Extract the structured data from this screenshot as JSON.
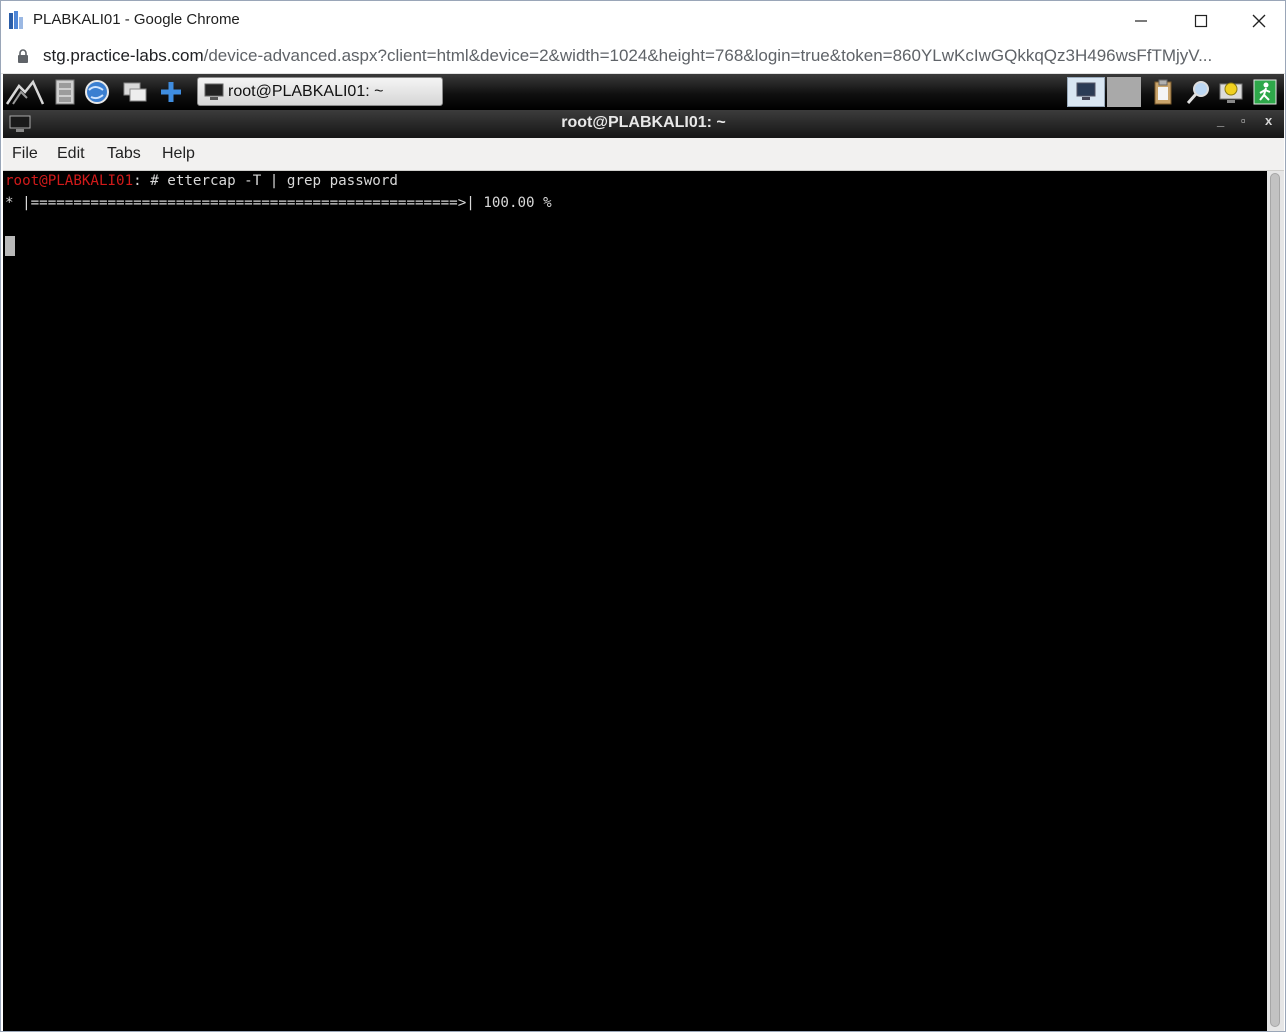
{
  "browser": {
    "window_title": "PLABKALI01 - Google Chrome",
    "url_host": "stg.practice-labs.com",
    "url_path": "/device-advanced.aspx?client=html&device=2&width=1024&height=768&login=true&token=860YLwKcIwGQkkqQz3H496wsFfTMjyV..."
  },
  "panel": {
    "task_button_label": "root@PLABKALI01: ~",
    "launcher_icons": [
      "kali-menu-icon",
      "file-cabinet-icon",
      "browser-globe-icon",
      "show-desktop-icon",
      "add-icon"
    ],
    "tray_icons": [
      "workspace-1-icon",
      "workspace-2-icon",
      "clipboard-icon",
      "search-magnifier-icon",
      "lightbulb-monitor-icon",
      "exit-icon"
    ]
  },
  "terminal": {
    "title": "root@PLABKALI01: ~",
    "controls": {
      "minimize": "_",
      "restore": "▫",
      "close": "x"
    },
    "menu": {
      "file": "File",
      "edit": "Edit",
      "tabs": "Tabs",
      "help": "Help"
    },
    "prompt_user": "root@PLABKALI01",
    "prompt_rest": ": # ettercap -T | grep password",
    "progress_line": "* |==================================================>| 100.00 %",
    "progress_percent": 100
  },
  "colors": {
    "prompt_red": "#d11a1a",
    "terminal_bg": "#000000",
    "terminal_fg": "#d8d8d8"
  }
}
